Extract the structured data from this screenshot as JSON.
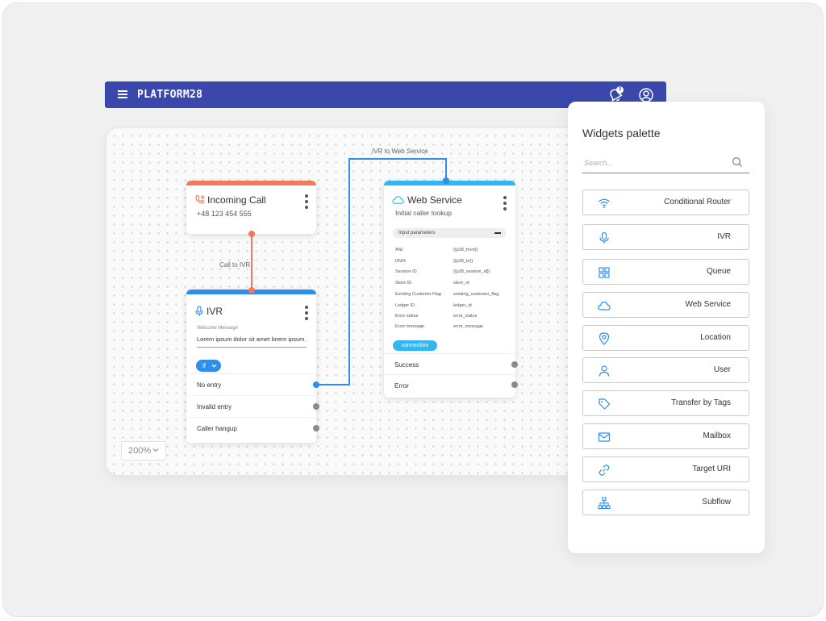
{
  "app": {
    "brand": "PLATFORM28",
    "notification_count": "3"
  },
  "canvas": {
    "zoom_value": "200%",
    "connections": {
      "call_to_ivr": "Call to IVR",
      "ivr_to_ws": "IVR to Web Service"
    }
  },
  "nodes": {
    "incoming_call": {
      "title": "Incoming Call",
      "phone": "+48 123 454 555",
      "accent": "#f0795a"
    },
    "ivr": {
      "title": "IVR",
      "field_label": "Welcome Message",
      "field_value": "Lorem ipsum dolor sit amet lorem ipsum...",
      "condition": "if",
      "outputs": [
        "No entry",
        "Invalid entry",
        "Caller hangup"
      ],
      "accent": "#2e8fea"
    },
    "web_service": {
      "title": "Web Service",
      "subtitle": "Initial caller lookup",
      "params_header": "Input parameters",
      "params": [
        {
          "key": "ANI",
          "value": "{{p28_from}}"
        },
        {
          "key": "DNIS",
          "value": "{{p28_to}}"
        },
        {
          "key": "Session ID",
          "value": "{{p28_session_id}}"
        },
        {
          "key": "Store ID",
          "value": "store_id"
        },
        {
          "key": "Existing Customer Flag",
          "value": "existing_customer_flag"
        },
        {
          "key": "Ledger ID",
          "value": "ledger_id"
        },
        {
          "key": "Error status",
          "value": "error_status"
        },
        {
          "key": "Error message",
          "value": "error_message"
        }
      ],
      "connection_label": "connection",
      "outputs": [
        "Success",
        "Error"
      ],
      "accent": "#30b7f3"
    }
  },
  "palette": {
    "title": "Widgets palette",
    "search_placeholder": "Search...",
    "widgets": [
      {
        "label": "Conditional Router",
        "icon": "wifi-icon"
      },
      {
        "label": "IVR",
        "icon": "microphone-icon"
      },
      {
        "label": "Queue",
        "icon": "grid-icon"
      },
      {
        "label": "Web Service",
        "icon": "cloud-icon"
      },
      {
        "label": "Location",
        "icon": "location-pin-icon"
      },
      {
        "label": "User",
        "icon": "user-icon"
      },
      {
        "label": "Transfer by Tags",
        "icon": "tag-icon"
      },
      {
        "label": "Mailbox",
        "icon": "mail-icon"
      },
      {
        "label": "Target URI",
        "icon": "link-icon"
      },
      {
        "label": "Subflow",
        "icon": "sitemap-icon"
      }
    ],
    "icon_color": "#2e8fea"
  }
}
